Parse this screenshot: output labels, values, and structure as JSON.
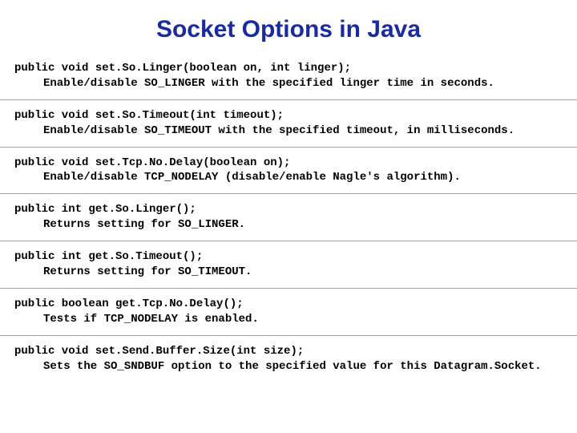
{
  "title": "Socket Options in Java",
  "methods": [
    {
      "signature": "public void set.So.Linger(boolean on, int linger);",
      "description": "Enable/disable SO_LINGER with the specified linger time in seconds."
    },
    {
      "signature": "public void set.So.Timeout(int timeout);",
      "description": "Enable/disable SO_TIMEOUT with the specified timeout, in milliseconds."
    },
    {
      "signature": "public void set.Tcp.No.Delay(boolean on);",
      "description": "Enable/disable TCP_NODELAY (disable/enable Nagle's algorithm)."
    },
    {
      "signature": "public int get.So.Linger();",
      "description": "Returns setting for SO_LINGER."
    },
    {
      "signature": "public int get.So.Timeout();",
      "description": "Returns setting for SO_TIMEOUT."
    },
    {
      "signature": "public boolean get.Tcp.No.Delay();",
      "description": "Tests if TCP_NODELAY is enabled."
    },
    {
      "signature": "public void set.Send.Buffer.Size(int size);",
      "description": "Sets the SO_SNDBUF option to the specified value for this Datagram.Socket."
    }
  ]
}
